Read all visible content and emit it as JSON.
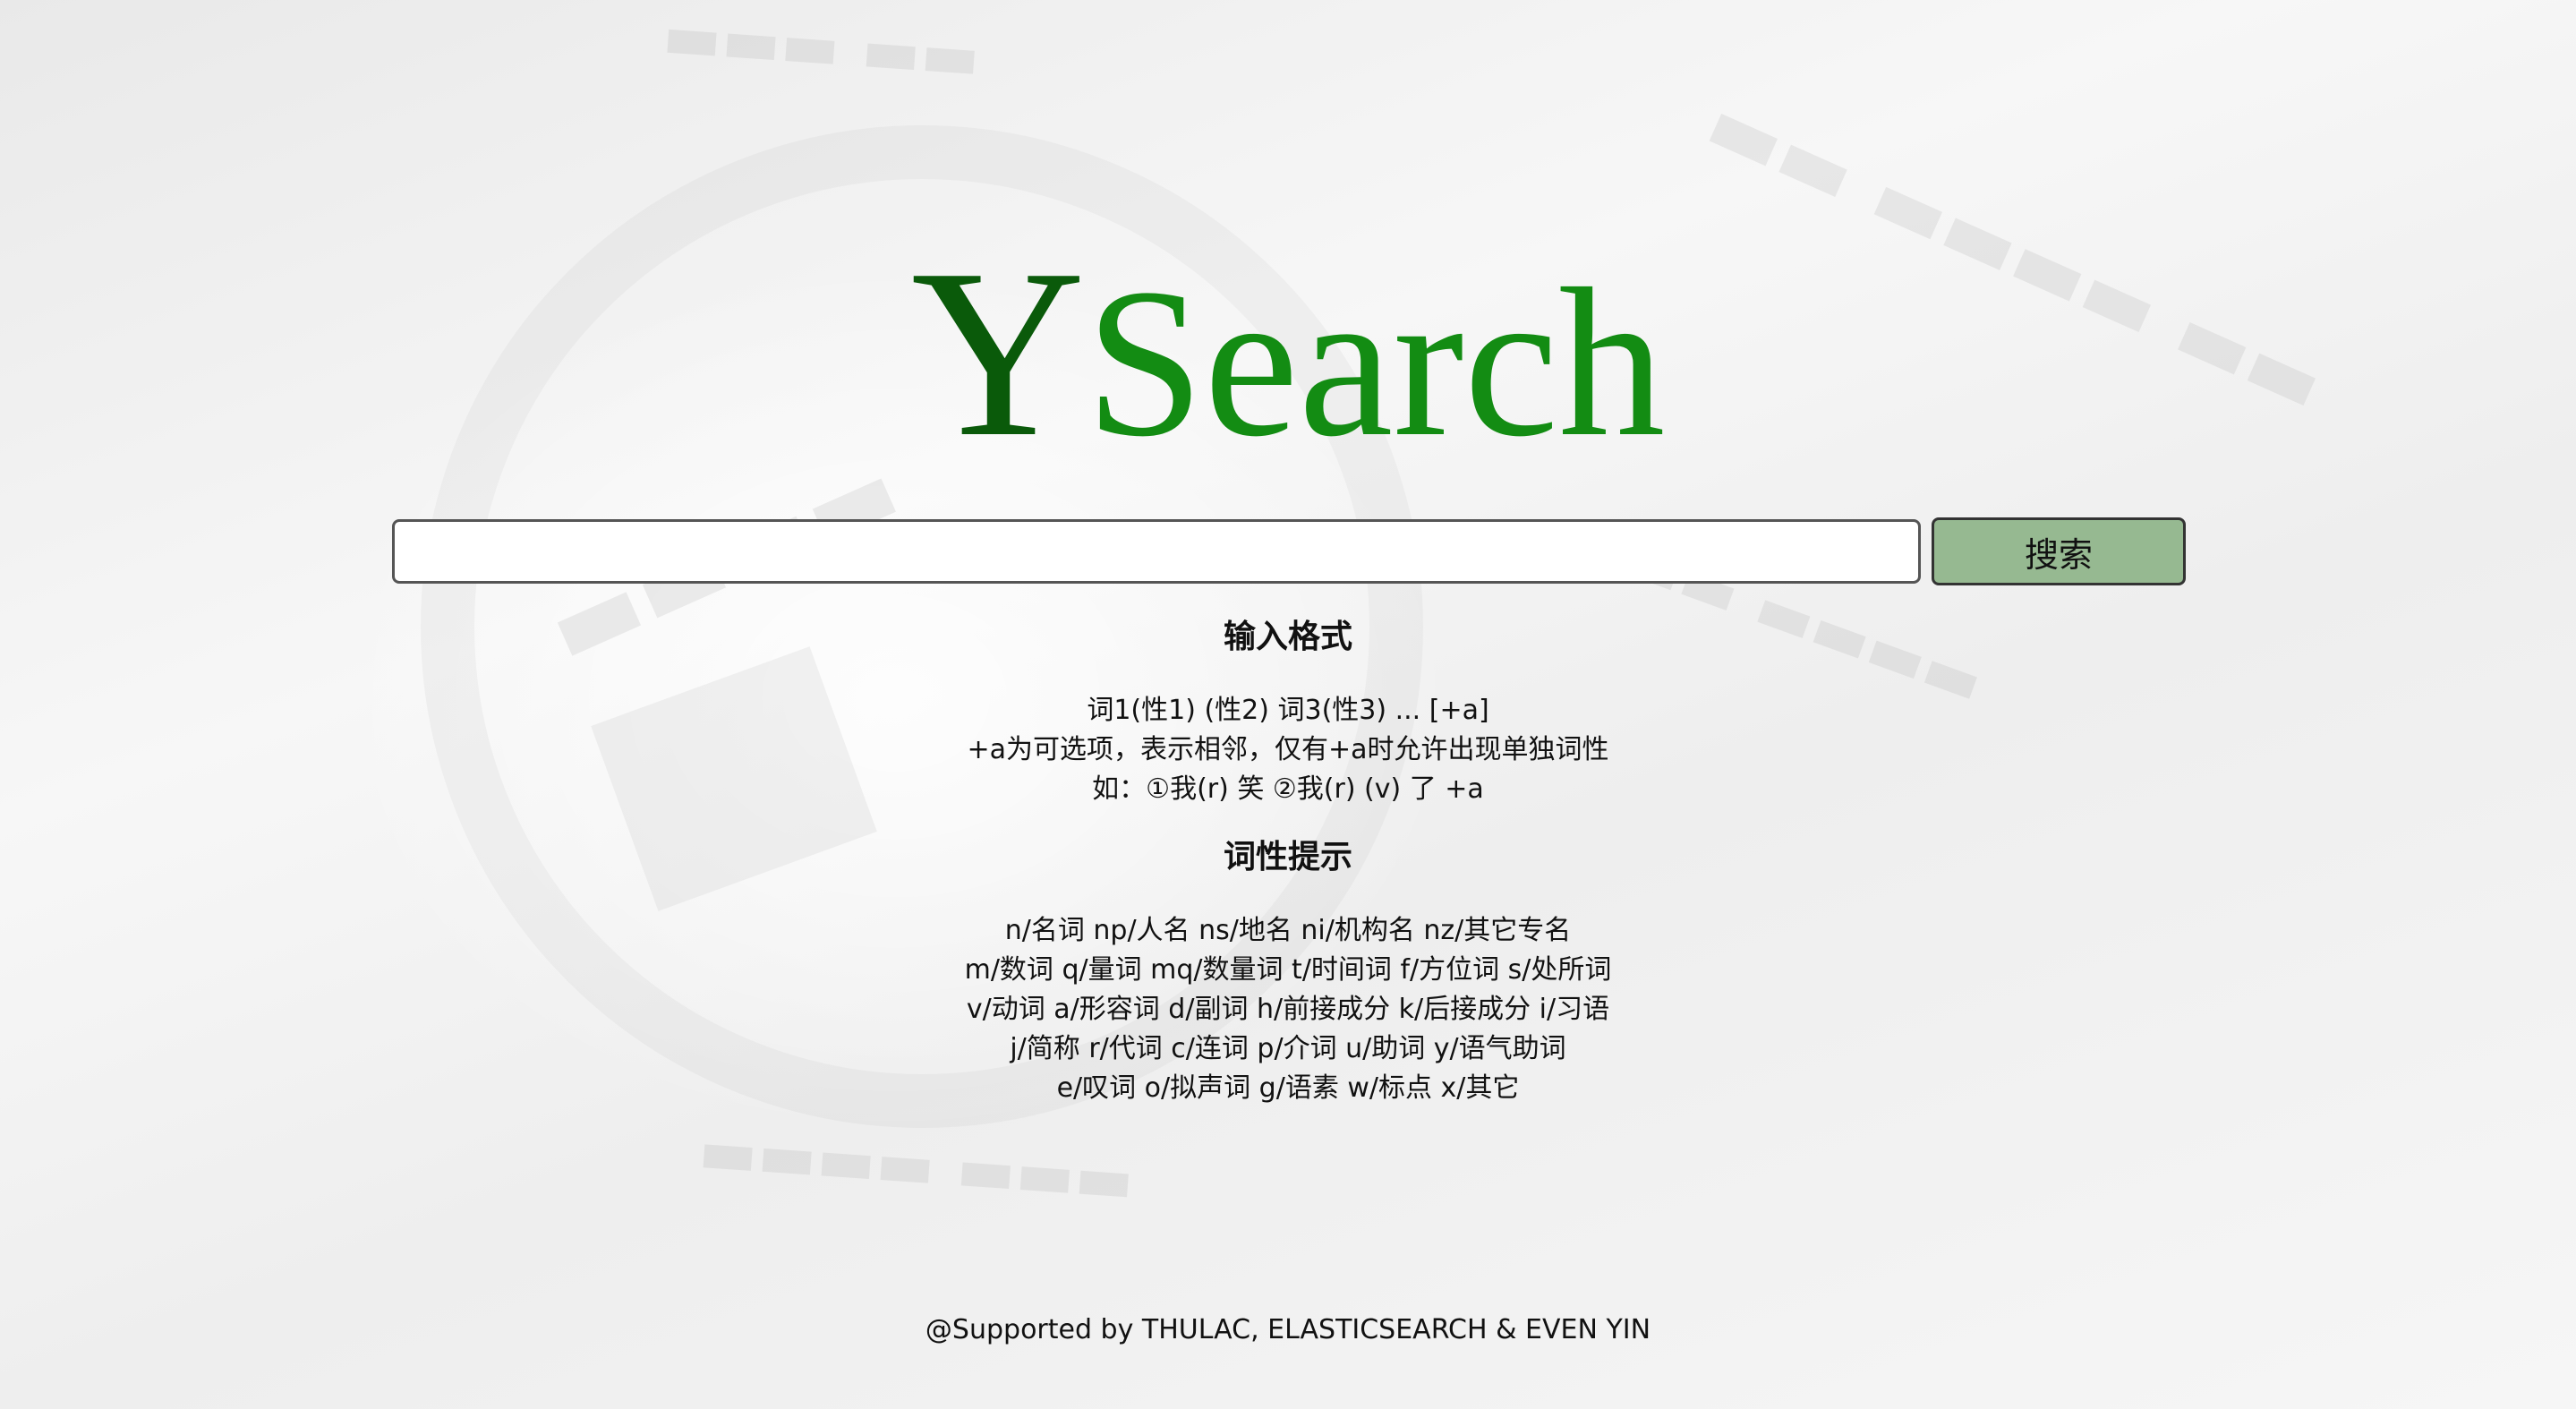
{
  "logo": {
    "first_letter": "Y",
    "rest": "Search"
  },
  "search": {
    "value": "",
    "placeholder": "",
    "button_label": "搜索"
  },
  "input_format": {
    "title": "输入格式",
    "lines": [
      "词1(性1) (性2) 词3(性3) ... [+a]",
      "+a为可选项，表示相邻，仅有+a时允许出现单独词性",
      "如：①我(r) 笑 ②我(r) (v) 了 +a"
    ]
  },
  "pos_hint": {
    "title": "词性提示",
    "lines": [
      "n/名词 np/人名 ns/地名 ni/机构名 nz/其它专名",
      "m/数词 q/量词 mq/数量词 t/时间词 f/方位词 s/处所词",
      "v/动词 a/形容词 d/副词 h/前接成分 k/后接成分 i/习语",
      "j/简称 r/代词 c/连词 p/介词 u/助词 y/语气助词",
      "e/叹词 o/拟声词 g/语素 w/标点 x/其它"
    ]
  },
  "footer": {
    "text": "@Supported by THULAC, ELASTICSEARCH & EVEN YIN"
  },
  "colors": {
    "logo_dark": "#0a5a0a",
    "logo_green": "#138c13",
    "button_bg": "#96b991"
  }
}
